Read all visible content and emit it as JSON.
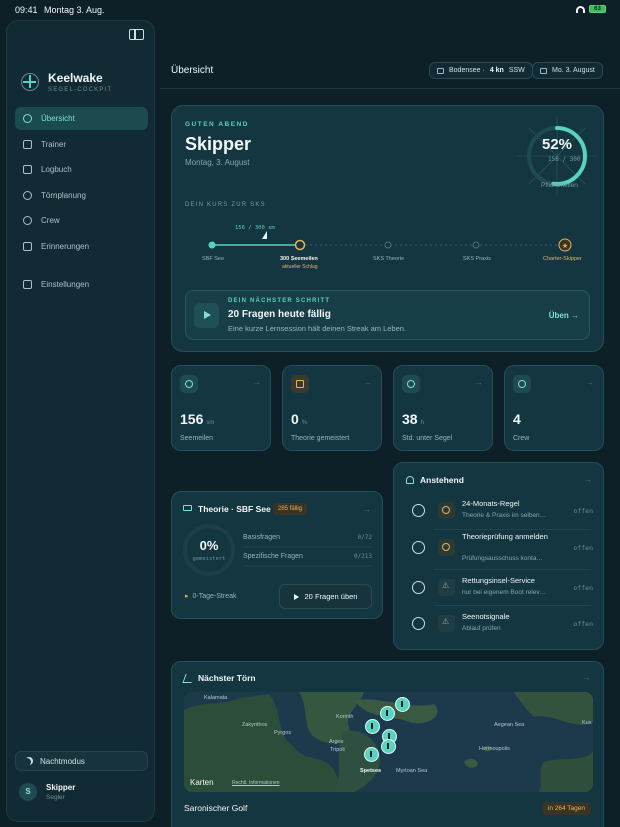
{
  "status_bar": {
    "time": "09:41",
    "date": "Montag 3. Aug.",
    "battery": "63"
  },
  "sidebar": {
    "brand": {
      "name": "Keelwake",
      "subtitle": "SEGEL-COCKPIT"
    },
    "items": [
      {
        "label": "Übersicht",
        "icon": "clock-icon",
        "active": true
      },
      {
        "label": "Trainer",
        "icon": "graduation-cap-icon"
      },
      {
        "label": "Logbuch",
        "icon": "book-icon"
      },
      {
        "label": "Törnplanung",
        "icon": "route-icon"
      },
      {
        "label": "Crew",
        "icon": "people-icon"
      },
      {
        "label": "Erinnerungen",
        "icon": "bell-icon"
      }
    ],
    "settings": {
      "label": "Einstellungen",
      "icon": "sliders-icon"
    },
    "night_mode": "Nachtmodus",
    "user": {
      "initial": "S",
      "name": "Skipper",
      "role": "Segler"
    }
  },
  "header": {
    "title": "Übersicht",
    "wind": {
      "location": "Bodensee ·",
      "value": "4 kn",
      "direction": "SSW"
    },
    "date": "Mo. 3. August"
  },
  "hero": {
    "kicker": "GUTEN ABEND",
    "name": "Skipper",
    "date": "Montag, 3. August",
    "progress": {
      "percent_label": "52%",
      "fraction_label": "156 / 300",
      "label": "Pflichtmeilen",
      "fraction": 0.52
    },
    "course": {
      "kicker": "DEIN KURS ZUR SKS",
      "progress_tag": "156 / 300 sm",
      "stops": [
        {
          "label": "SBF See",
          "state": "done"
        },
        {
          "label": "300 Seemeilen",
          "sub": "aktueller Schlag",
          "state": "current"
        },
        {
          "label": "SKS Theorie",
          "state": "todo"
        },
        {
          "label": "SKS Praxis",
          "state": "todo"
        },
        {
          "label": "Charter-Skipper",
          "state": "goal"
        }
      ]
    },
    "next_step": {
      "kicker": "DEIN NÄCHSTER SCHRITT",
      "title": "20 Fragen heute fällig",
      "description": "Eine kurze Lernsession hält deinen Streak am Leben.",
      "cta": "Üben →"
    }
  },
  "stats": [
    {
      "value": "156",
      "unit": "sm",
      "label": "Seemeilen",
      "icon": "compass-icon"
    },
    {
      "value": "0",
      "unit": "%",
      "label": "Theorie gemeistert",
      "icon": "graduation-cap-icon"
    },
    {
      "value": "38",
      "unit": "h",
      "label": "Std. unter Segel",
      "icon": "boat-icon"
    },
    {
      "value": "4",
      "unit": "",
      "label": "Crew",
      "icon": "people-icon"
    }
  ],
  "theory": {
    "title": "Theorie · SBF See",
    "badge": "285 fällig",
    "percent": "0%",
    "percent_sub": "gemeistert",
    "rows": [
      {
        "label": "Basisfragen",
        "count": "0/72",
        "fraction": 0
      },
      {
        "label": "Spezifische Fragen",
        "count": "0/213",
        "fraction": 0
      }
    ],
    "streak": "0-Tage-Streak",
    "button": "20 Fragen üben"
  },
  "upcoming": {
    "title": "Anstehend",
    "items": [
      {
        "title": "24-Monats-Regel",
        "subtitle": "Theorie & Praxis im selben…",
        "status": "offen",
        "icon": "clock-icon"
      },
      {
        "title": "Theorieprüfung anmelden",
        "subtitle": "Prüfungsausschuss konta…",
        "status": "offen",
        "icon": "clock-icon"
      },
      {
        "title": "Rettungsinsel-Service",
        "subtitle": "nur bei eigenem Boot relev…",
        "status": "offen",
        "icon": "warning-icon"
      },
      {
        "title": "Seenotsignale",
        "subtitle": "Ablauf prüfen",
        "status": "offen",
        "icon": "warning-icon"
      }
    ]
  },
  "trip": {
    "title": "Nächster Törn",
    "area": "Saronischer Golf",
    "badge": "in 264 Tagen",
    "map": {
      "brand": "Karten",
      "legal": "Rechtl. Informationen",
      "labels": [
        "Kalamata",
        "Korinth",
        "Argos",
        "Tripoli",
        "Hermoupolis",
        "Spetses",
        "Zakynthos",
        "Pyrgos",
        "Kus",
        "Myrtoan Sea",
        "Aegean Sea"
      ]
    }
  }
}
